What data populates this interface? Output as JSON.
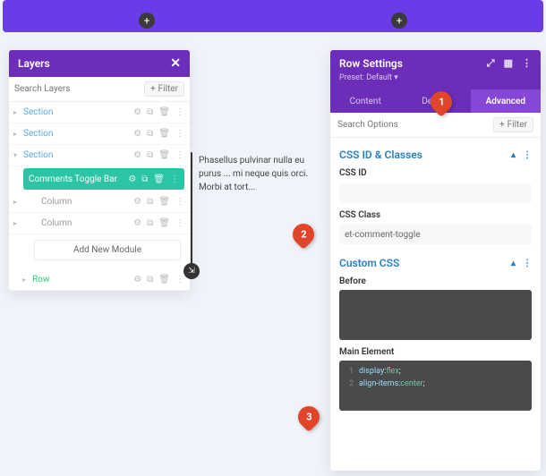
{
  "topbar": {
    "plus": "+"
  },
  "layers": {
    "title": "Layers",
    "close": "✕",
    "search_placeholder": "Search Layers",
    "filter_label": "Filter",
    "sections": [
      "Section",
      "Section",
      "Section"
    ],
    "active_module": "Comments Toggle Bar",
    "columns": [
      "Column",
      "Column"
    ],
    "add_module": "Add New Module",
    "row_label": "Row"
  },
  "lorem": "Phasellus pulvinar nulla eu purus ... mi neque quis orci. Morbi at tort...",
  "settings": {
    "title": "Row Settings",
    "preset": "Preset: Default ▾",
    "tabs": [
      "Content",
      "Design",
      "Advanced"
    ],
    "active_tab": 2,
    "search_placeholder": "Search Options",
    "filter_label": "Filter",
    "group_css": "CSS ID & Classes",
    "css_id_label": "CSS ID",
    "css_id_value": "",
    "css_class_label": "CSS Class",
    "css_class_value": "et-comment-toggle",
    "group_custom": "Custom CSS",
    "before_label": "Before",
    "main_label": "Main Element",
    "code_lines": [
      {
        "n": "1",
        "kw": "display",
        "val": "flex"
      },
      {
        "n": "2",
        "kw": "align-items",
        "val": "center"
      }
    ]
  },
  "callouts": {
    "one": "1",
    "two": "2",
    "three": "3"
  },
  "icons": {
    "gear": "⚙",
    "copy": "⧉",
    "trash": "🗑",
    "plus": "+"
  }
}
